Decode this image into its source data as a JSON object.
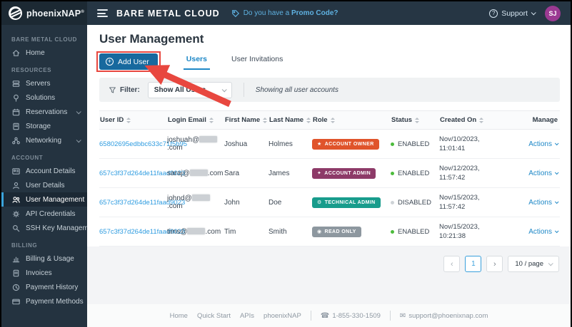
{
  "topbar": {
    "brand": "phoenixNAP",
    "brand_mark": "®",
    "app_title": "BARE METAL CLOUD",
    "promo_prefix": "Do you have a ",
    "promo_link": "Promo Code?",
    "support_label": "Support",
    "avatar_initials": "SJ",
    "colors": {
      "bar_bg": "#263644",
      "logo_bg": "#1c2933",
      "promo_blue": "#5fb2e2",
      "avatar_purple": "#9b3a92"
    }
  },
  "sidebar": {
    "colors": {
      "bg": "#243340",
      "active_accent": "#3aa4dc"
    },
    "sections": [
      {
        "header": "BARE METAL CLOUD",
        "items": [
          {
            "label": "Home"
          }
        ]
      },
      {
        "header": "RESOURCES",
        "items": [
          {
            "label": "Servers"
          },
          {
            "label": "Solutions"
          },
          {
            "label": "Reservations",
            "expandable": true
          },
          {
            "label": "Storage"
          },
          {
            "label": "Networking",
            "expandable": true
          }
        ]
      },
      {
        "header": "ACCOUNT",
        "items": [
          {
            "label": "Account Details"
          },
          {
            "label": "User Details"
          },
          {
            "label": "User Management",
            "active": true
          },
          {
            "label": "API Credentials"
          },
          {
            "label": "SSH Key Management"
          }
        ]
      },
      {
        "header": "BILLING",
        "items": [
          {
            "label": "Billing & Usage"
          },
          {
            "label": "Invoices"
          },
          {
            "label": "Payment History"
          },
          {
            "label": "Payment Methods"
          }
        ]
      }
    ]
  },
  "main": {
    "title": "User Management",
    "add_user_button": "Add User",
    "tabs": [
      {
        "label": "Users",
        "active": true
      },
      {
        "label": "User Invitations",
        "active": false
      }
    ],
    "filter": {
      "label": "Filter:",
      "selected_option": "Show All Users",
      "summary": "Showing all user accounts"
    },
    "table": {
      "columns": [
        "User ID",
        "Login Email",
        "First Name",
        "Last Name",
        "Role",
        "Status",
        "Created On",
        "Manage"
      ],
      "rows": [
        {
          "user_id": "65802695edbbc633c71f5b95",
          "email_prefix": "joshuah@",
          "email_redacted": true,
          "email_suffix": ".com",
          "first_name": "Joshua",
          "last_name": "Holmes",
          "role": "ACCOUNT OWNER",
          "role_color": "#E0542B",
          "role_icon_glyph": "★",
          "status": "ENABLED",
          "status_color": "#4cbb3c",
          "created_date": "Nov/10/2023,",
          "created_time": "11:01:41",
          "manage_label": "Actions"
        },
        {
          "user_id": "657c3f37d264de11faad9023",
          "email_prefix": "saraj@",
          "email_redacted": true,
          "email_suffix": ".com",
          "first_name": "Sara",
          "last_name": "James",
          "role": "ACCOUNT ADMIN",
          "role_color": "#8D3A68",
          "role_icon_glyph": "✦",
          "status": "ENABLED",
          "status_color": "#4cbb3c",
          "created_date": "Nov/12/2023,",
          "created_time": "11:57:42",
          "manage_label": "Actions"
        },
        {
          "user_id": "657c3f37d264de11faad9023",
          "email_prefix": "johnd@",
          "email_redacted": true,
          "email_suffix": ".com",
          "first_name": "John",
          "last_name": "Doe",
          "role": "TECHNICAL ADMIN",
          "role_color": "#189C8C",
          "role_icon_glyph": "⚙",
          "status": "DISABLED",
          "status_color": "#ced3d7",
          "created_date": "Nov/15/2023,",
          "created_time": "11:57:42",
          "manage_label": "Actions"
        },
        {
          "user_id": "657c3f37d264de11faad9023",
          "email_prefix": "tims@",
          "email_redacted": true,
          "email_suffix": ".com",
          "first_name": "Tim",
          "last_name": "Smith",
          "role": "READ ONLY",
          "role_color": "#8D979F",
          "role_icon_glyph": "◉",
          "status": "ENABLED",
          "status_color": "#4cbb3c",
          "created_date": "Nov/15/2023,",
          "created_time": "10:21:38",
          "manage_label": "Actions"
        }
      ]
    },
    "pagination": {
      "prev": "‹",
      "page": "1",
      "next": "›",
      "page_size": "10 / page"
    }
  },
  "footer": {
    "links": [
      "Home",
      "Quick Start",
      "APIs",
      "phoenixNAP"
    ],
    "phone": "1-855-330-1509",
    "email": "support@phoenixnap.com"
  },
  "annotation": {
    "type": "arrow-and-box-highlighting-add-user-button",
    "color": "#E8473F"
  }
}
